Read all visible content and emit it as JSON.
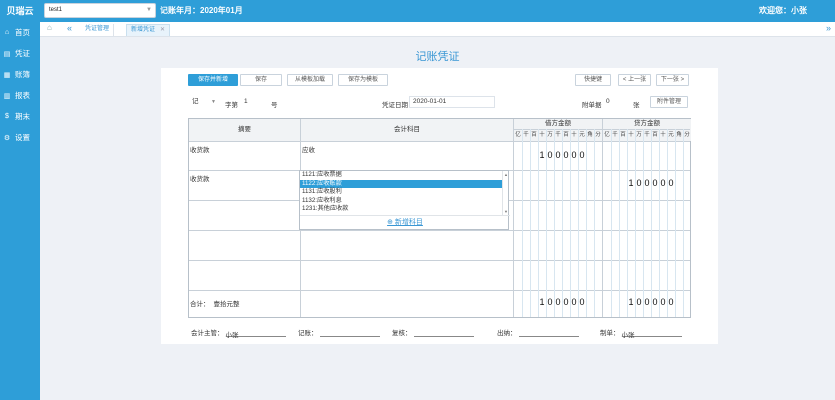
{
  "header": {
    "brand": "贝瑞云",
    "company": "test1",
    "period": "记账年月：2020年01月",
    "welcome": "欢迎您：小张"
  },
  "sidebar": {
    "items": [
      {
        "label": "首页",
        "icon": "home-icon"
      },
      {
        "label": "凭证",
        "icon": "document-icon"
      },
      {
        "label": "账簿",
        "icon": "books-icon"
      },
      {
        "label": "报表",
        "icon": "chart-icon"
      },
      {
        "label": "期末",
        "icon": "dollar-icon"
      },
      {
        "label": "设置",
        "icon": "gear-icon"
      }
    ]
  },
  "tabs": {
    "items": [
      "凭证管理",
      "新增凭证"
    ],
    "active": 1
  },
  "page": {
    "title": "记账凭证"
  },
  "toolbar": {
    "save_new": "保存并新增",
    "save": "保存",
    "from_template": "从模板加载",
    "save_template": "保存为模板",
    "shortcut": "快捷键",
    "prev": "< 上一张",
    "next": "下一张 >"
  },
  "voucher": {
    "word": "记",
    "word_label": "字第",
    "number": "1",
    "number_unit": "号",
    "date_label": "凭证日期",
    "date": "2020-01-01",
    "attach_label": "附单据",
    "attach_count": "0",
    "attach_unit": "张",
    "attach_button": "附件管理"
  },
  "table": {
    "col_summary": "摘要",
    "col_account": "会计科目",
    "col_debit": "借方金额",
    "col_credit": "贷方金额",
    "units": [
      "亿",
      "千",
      "百",
      "十",
      "万",
      "千",
      "百",
      "十",
      "元",
      "角",
      "分"
    ],
    "rows": [
      {
        "summary": "收货款",
        "account": "应收",
        "debit": "100000",
        "credit": ""
      },
      {
        "summary": "收货款",
        "account": "",
        "debit": "",
        "credit": "100000"
      },
      {
        "summary": "",
        "account": "",
        "debit": "",
        "credit": ""
      },
      {
        "summary": "",
        "account": "",
        "debit": "",
        "credit": ""
      },
      {
        "summary": "",
        "account": "",
        "debit": "",
        "credit": ""
      }
    ],
    "total_label": "合计：",
    "total_words": "壹拾元整",
    "total_debit": "100000",
    "total_credit": "100000"
  },
  "dropdown": {
    "items": [
      "1121:应收票据",
      "1122:应收账款",
      "1131:应收股利",
      "1132:应收利息",
      "1231:其他应收款"
    ],
    "selected": 1,
    "add_label": "⊕ 新增科目"
  },
  "signatures": [
    {
      "label": "会计主管：",
      "value": "小张"
    },
    {
      "label": "记账：",
      "value": ""
    },
    {
      "label": "复核：",
      "value": ""
    },
    {
      "label": "出纳：",
      "value": ""
    },
    {
      "label": "制单：",
      "value": "小张"
    }
  ]
}
